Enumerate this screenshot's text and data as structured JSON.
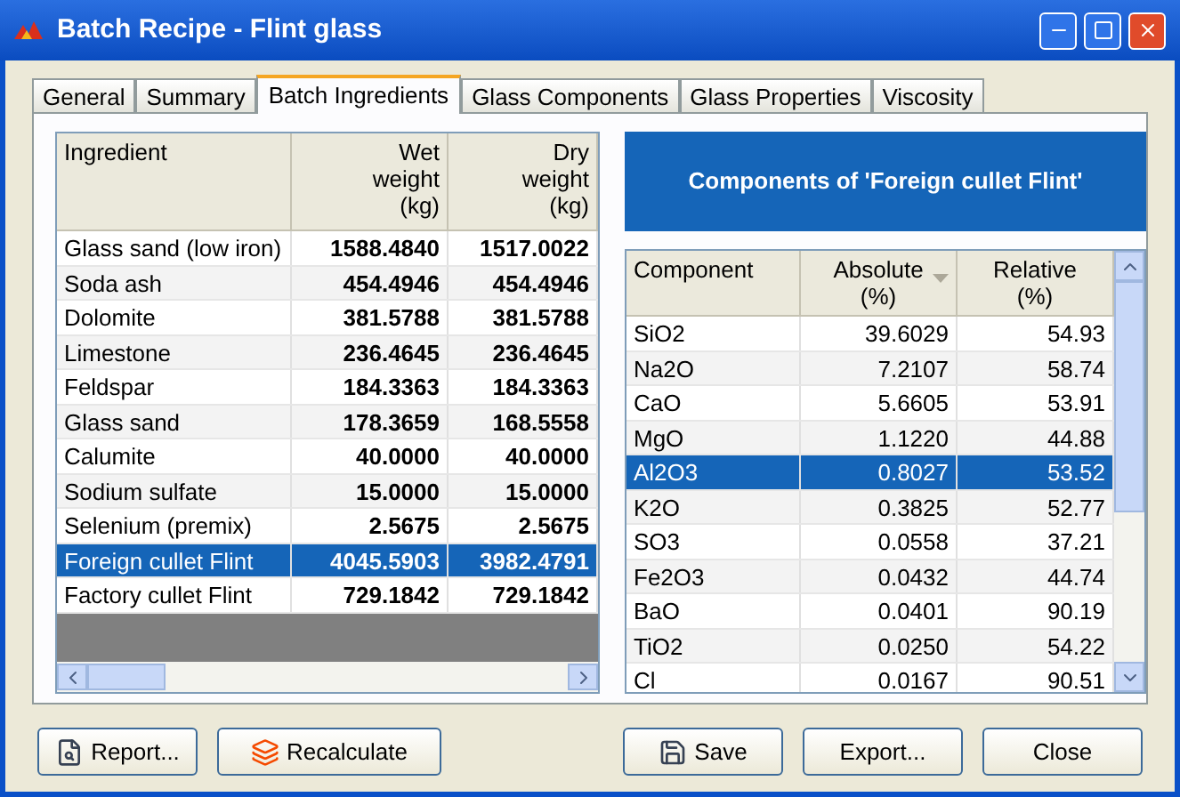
{
  "window": {
    "title": "Batch Recipe - Flint glass"
  },
  "tabs": [
    {
      "label": "General",
      "selected": false
    },
    {
      "label": "Summary",
      "selected": false
    },
    {
      "label": "Batch Ingredients",
      "selected": true
    },
    {
      "label": "Glass Components",
      "selected": false
    },
    {
      "label": "Glass Properties",
      "selected": false
    },
    {
      "label": "Viscosity",
      "selected": false
    }
  ],
  "ingredients": {
    "columns": [
      "Ingredient",
      "Wet\nweight\n(kg)",
      "Dry\nweight\n(kg)"
    ],
    "rows": [
      {
        "cells": [
          "Glass sand (low iron)",
          "1588.4840",
          "1517.0022"
        ],
        "selected": false
      },
      {
        "cells": [
          "Soda ash",
          "454.4946",
          "454.4946"
        ],
        "selected": false
      },
      {
        "cells": [
          "Dolomite",
          "381.5788",
          "381.5788"
        ],
        "selected": false
      },
      {
        "cells": [
          "Limestone",
          "236.4645",
          "236.4645"
        ],
        "selected": false
      },
      {
        "cells": [
          "Feldspar",
          "184.3363",
          "184.3363"
        ],
        "selected": false
      },
      {
        "cells": [
          "Glass sand",
          "178.3659",
          "168.5558"
        ],
        "selected": false
      },
      {
        "cells": [
          "Calumite",
          "40.0000",
          "40.0000"
        ],
        "selected": false
      },
      {
        "cells": [
          "Sodium sulfate",
          "15.0000",
          "15.0000"
        ],
        "selected": false
      },
      {
        "cells": [
          "Selenium (premix)",
          "2.5675",
          "2.5675"
        ],
        "selected": false
      },
      {
        "cells": [
          "Foreign cullet Flint",
          "4045.5903",
          "3982.4791"
        ],
        "selected": true
      },
      {
        "cells": [
          "Factory cullet Flint",
          "729.1842",
          "729.1842"
        ],
        "selected": false
      }
    ]
  },
  "components": {
    "title": "Components of 'Foreign cullet Flint'",
    "columns": [
      {
        "label": "Component",
        "sorted": false
      },
      {
        "label": "Absolute\n(%)",
        "sorted": true
      },
      {
        "label": "Relative\n(%)",
        "sorted": false
      }
    ],
    "rows": [
      {
        "cells": [
          "SiO2",
          "39.6029",
          "54.93"
        ],
        "selected": false
      },
      {
        "cells": [
          "Na2O",
          "7.2107",
          "58.74"
        ],
        "selected": false
      },
      {
        "cells": [
          "CaO",
          "5.6605",
          "53.91"
        ],
        "selected": false
      },
      {
        "cells": [
          "MgO",
          "1.1220",
          "44.88"
        ],
        "selected": false
      },
      {
        "cells": [
          "Al2O3",
          "0.8027",
          "53.52"
        ],
        "selected": true
      },
      {
        "cells": [
          "K2O",
          "0.3825",
          "52.77"
        ],
        "selected": false
      },
      {
        "cells": [
          "SO3",
          "0.0558",
          "37.21"
        ],
        "selected": false
      },
      {
        "cells": [
          "Fe2O3",
          "0.0432",
          "44.74"
        ],
        "selected": false
      },
      {
        "cells": [
          "BaO",
          "0.0401",
          "90.19"
        ],
        "selected": false
      },
      {
        "cells": [
          "TiO2",
          "0.0250",
          "54.22"
        ],
        "selected": false
      },
      {
        "cells": [
          "Cl",
          "0.0167",
          "90.51"
        ],
        "selected": false
      }
    ]
  },
  "buttons_left": [
    {
      "label": "Report...",
      "kind": "report"
    },
    {
      "label": "Recalculate",
      "kind": "recalculate"
    }
  ],
  "buttons_right": [
    {
      "label": "Save",
      "kind": "save"
    },
    {
      "label": "Export...",
      "kind": "plain"
    },
    {
      "label": "Close",
      "kind": "plain"
    }
  ]
}
